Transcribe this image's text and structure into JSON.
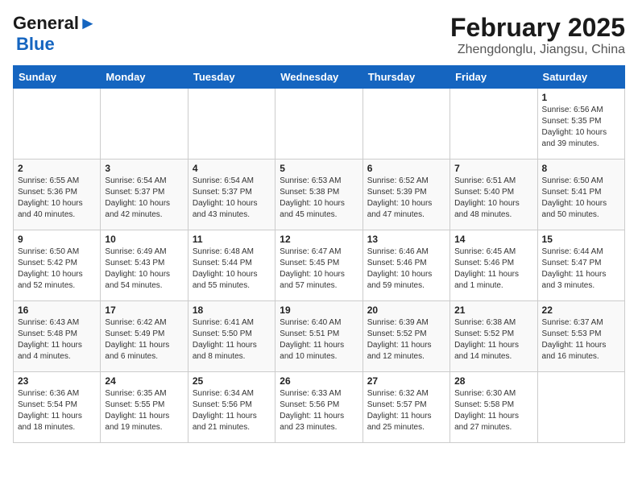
{
  "header": {
    "logo_line1": "General",
    "logo_line2": "Blue",
    "title": "February 2025",
    "subtitle": "Zhengdonglu, Jiangsu, China"
  },
  "days_of_week": [
    "Sunday",
    "Monday",
    "Tuesday",
    "Wednesday",
    "Thursday",
    "Friday",
    "Saturday"
  ],
  "weeks": [
    [
      {
        "day": "",
        "info": ""
      },
      {
        "day": "",
        "info": ""
      },
      {
        "day": "",
        "info": ""
      },
      {
        "day": "",
        "info": ""
      },
      {
        "day": "",
        "info": ""
      },
      {
        "day": "",
        "info": ""
      },
      {
        "day": "1",
        "info": "Sunrise: 6:56 AM\nSunset: 5:35 PM\nDaylight: 10 hours and 39 minutes."
      }
    ],
    [
      {
        "day": "2",
        "info": "Sunrise: 6:55 AM\nSunset: 5:36 PM\nDaylight: 10 hours and 40 minutes."
      },
      {
        "day": "3",
        "info": "Sunrise: 6:54 AM\nSunset: 5:37 PM\nDaylight: 10 hours and 42 minutes."
      },
      {
        "day": "4",
        "info": "Sunrise: 6:54 AM\nSunset: 5:37 PM\nDaylight: 10 hours and 43 minutes."
      },
      {
        "day": "5",
        "info": "Sunrise: 6:53 AM\nSunset: 5:38 PM\nDaylight: 10 hours and 45 minutes."
      },
      {
        "day": "6",
        "info": "Sunrise: 6:52 AM\nSunset: 5:39 PM\nDaylight: 10 hours and 47 minutes."
      },
      {
        "day": "7",
        "info": "Sunrise: 6:51 AM\nSunset: 5:40 PM\nDaylight: 10 hours and 48 minutes."
      },
      {
        "day": "8",
        "info": "Sunrise: 6:50 AM\nSunset: 5:41 PM\nDaylight: 10 hours and 50 minutes."
      }
    ],
    [
      {
        "day": "9",
        "info": "Sunrise: 6:50 AM\nSunset: 5:42 PM\nDaylight: 10 hours and 52 minutes."
      },
      {
        "day": "10",
        "info": "Sunrise: 6:49 AM\nSunset: 5:43 PM\nDaylight: 10 hours and 54 minutes."
      },
      {
        "day": "11",
        "info": "Sunrise: 6:48 AM\nSunset: 5:44 PM\nDaylight: 10 hours and 55 minutes."
      },
      {
        "day": "12",
        "info": "Sunrise: 6:47 AM\nSunset: 5:45 PM\nDaylight: 10 hours and 57 minutes."
      },
      {
        "day": "13",
        "info": "Sunrise: 6:46 AM\nSunset: 5:46 PM\nDaylight: 10 hours and 59 minutes."
      },
      {
        "day": "14",
        "info": "Sunrise: 6:45 AM\nSunset: 5:46 PM\nDaylight: 11 hours and 1 minute."
      },
      {
        "day": "15",
        "info": "Sunrise: 6:44 AM\nSunset: 5:47 PM\nDaylight: 11 hours and 3 minutes."
      }
    ],
    [
      {
        "day": "16",
        "info": "Sunrise: 6:43 AM\nSunset: 5:48 PM\nDaylight: 11 hours and 4 minutes."
      },
      {
        "day": "17",
        "info": "Sunrise: 6:42 AM\nSunset: 5:49 PM\nDaylight: 11 hours and 6 minutes."
      },
      {
        "day": "18",
        "info": "Sunrise: 6:41 AM\nSunset: 5:50 PM\nDaylight: 11 hours and 8 minutes."
      },
      {
        "day": "19",
        "info": "Sunrise: 6:40 AM\nSunset: 5:51 PM\nDaylight: 11 hours and 10 minutes."
      },
      {
        "day": "20",
        "info": "Sunrise: 6:39 AM\nSunset: 5:52 PM\nDaylight: 11 hours and 12 minutes."
      },
      {
        "day": "21",
        "info": "Sunrise: 6:38 AM\nSunset: 5:52 PM\nDaylight: 11 hours and 14 minutes."
      },
      {
        "day": "22",
        "info": "Sunrise: 6:37 AM\nSunset: 5:53 PM\nDaylight: 11 hours and 16 minutes."
      }
    ],
    [
      {
        "day": "23",
        "info": "Sunrise: 6:36 AM\nSunset: 5:54 PM\nDaylight: 11 hours and 18 minutes."
      },
      {
        "day": "24",
        "info": "Sunrise: 6:35 AM\nSunset: 5:55 PM\nDaylight: 11 hours and 19 minutes."
      },
      {
        "day": "25",
        "info": "Sunrise: 6:34 AM\nSunset: 5:56 PM\nDaylight: 11 hours and 21 minutes."
      },
      {
        "day": "26",
        "info": "Sunrise: 6:33 AM\nSunset: 5:56 PM\nDaylight: 11 hours and 23 minutes."
      },
      {
        "day": "27",
        "info": "Sunrise: 6:32 AM\nSunset: 5:57 PM\nDaylight: 11 hours and 25 minutes."
      },
      {
        "day": "28",
        "info": "Sunrise: 6:30 AM\nSunset: 5:58 PM\nDaylight: 11 hours and 27 minutes."
      },
      {
        "day": "",
        "info": ""
      }
    ]
  ]
}
